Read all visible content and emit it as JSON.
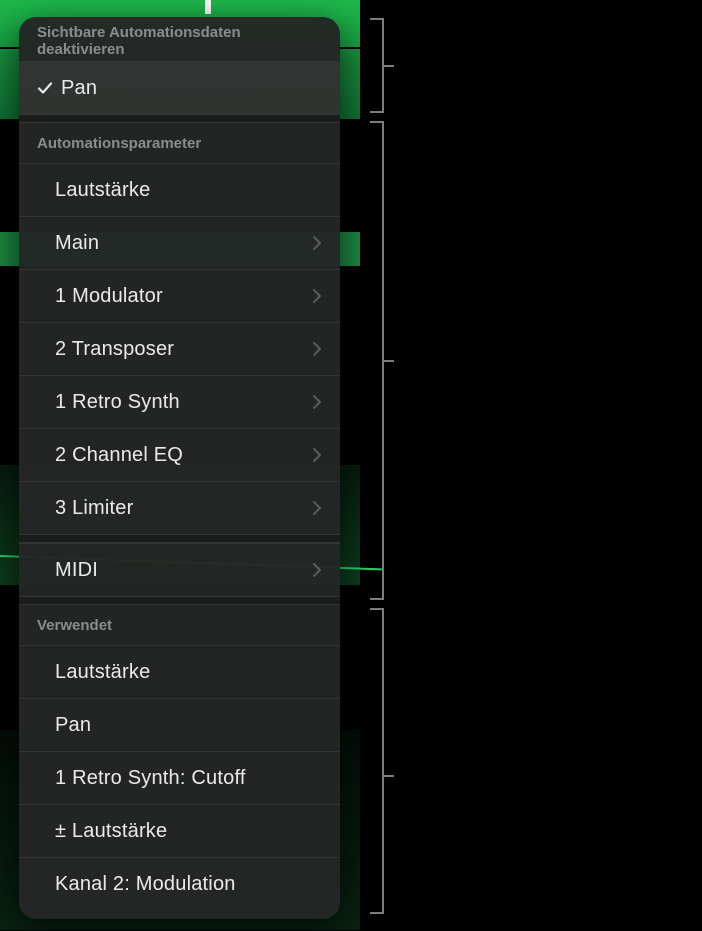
{
  "header": {
    "disable_visible_automation": "Sichtbare Automationsdaten deaktivieren"
  },
  "selected": {
    "label": "Pan"
  },
  "section_params": {
    "title": "Automationsparameter",
    "items": [
      {
        "label": "Lautstärke",
        "submenu": false
      },
      {
        "label": "Main",
        "submenu": true
      },
      {
        "label": "1 Modulator",
        "submenu": true
      },
      {
        "label": "2 Transposer",
        "submenu": true
      },
      {
        "label": "1 Retro Synth",
        "submenu": true
      },
      {
        "label": "2 Channel EQ",
        "submenu": true
      },
      {
        "label": "3 Limiter",
        "submenu": true
      }
    ],
    "midi": {
      "label": "MIDI",
      "submenu": true
    }
  },
  "section_used": {
    "title": "Verwendet",
    "items": [
      {
        "label": "Lautstärke"
      },
      {
        "label": "Pan"
      },
      {
        "label": "1 Retro Synth: Cutoff"
      },
      {
        "label": "± Lautstärke"
      },
      {
        "label": "Kanal 2: Modulation"
      }
    ]
  }
}
